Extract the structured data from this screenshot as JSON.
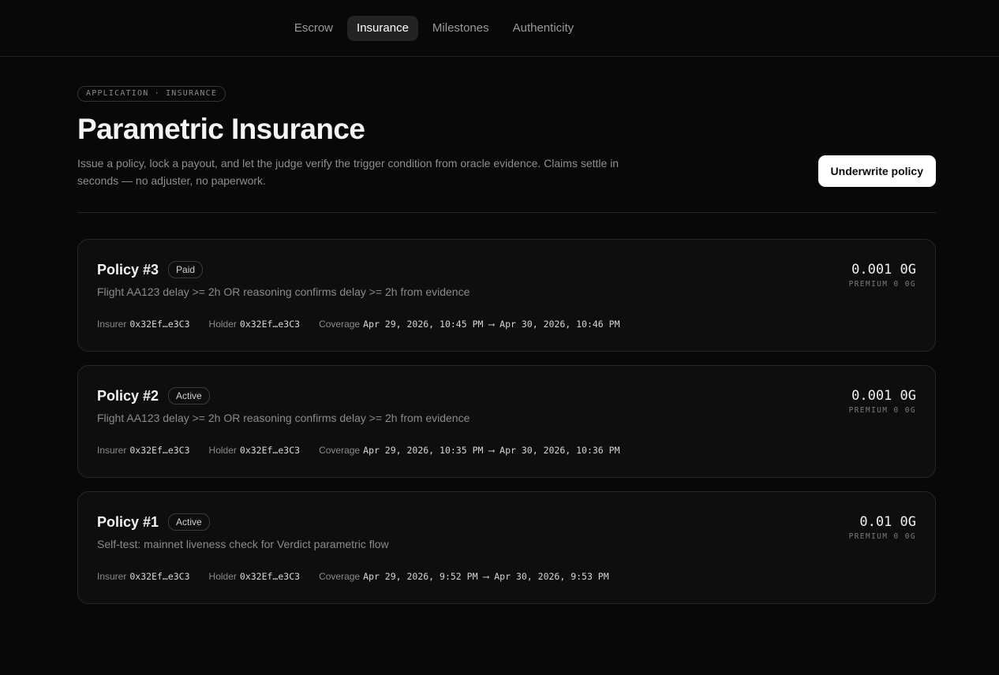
{
  "nav": {
    "tabs": [
      {
        "label": "Escrow"
      },
      {
        "label": "Insurance"
      },
      {
        "label": "Milestones"
      },
      {
        "label": "Authenticity"
      }
    ],
    "active_tab": "Insurance"
  },
  "header": {
    "eyebrow": "APPLICATION · INSURANCE",
    "title": "Parametric Insurance",
    "subtitle": "Issue a policy, lock a payout, and let the judge verify the trigger condition from oracle evidence. Claims settle in seconds — no adjuster, no paperwork.",
    "cta_label": "Underwrite policy"
  },
  "policies": [
    {
      "title": "Policy #3",
      "status": "Paid",
      "description": "Flight AA123 delay >= 2h OR reasoning confirms delay >= 2h from evidence",
      "amount": "0.001 0G",
      "premium": "PREMIUM 0 0G",
      "insurer_label": "Insurer",
      "insurer": "0x32Ef…e3C3",
      "holder_label": "Holder",
      "holder": "0x32Ef…e3C3",
      "coverage_label": "Coverage",
      "coverage": "Apr 29, 2026, 10:45 PM ⟶ Apr 30, 2026, 10:46 PM"
    },
    {
      "title": "Policy #2",
      "status": "Active",
      "description": "Flight AA123 delay >= 2h OR reasoning confirms delay >= 2h from evidence",
      "amount": "0.001 0G",
      "premium": "PREMIUM 0 0G",
      "insurer_label": "Insurer",
      "insurer": "0x32Ef…e3C3",
      "holder_label": "Holder",
      "holder": "0x32Ef…e3C3",
      "coverage_label": "Coverage",
      "coverage": "Apr 29, 2026, 10:35 PM ⟶ Apr 30, 2026, 10:36 PM"
    },
    {
      "title": "Policy #1",
      "status": "Active",
      "description": "Self-test: mainnet liveness check for Verdict parametric flow",
      "amount": "0.01 0G",
      "premium": "PREMIUM 0 0G",
      "insurer_label": "Insurer",
      "insurer": "0x32Ef…e3C3",
      "holder_label": "Holder",
      "holder": "0x32Ef…e3C3",
      "coverage_label": "Coverage",
      "coverage": "Apr 29, 2026, 9:52 PM ⟶ Apr 30, 2026, 9:53 PM"
    }
  ]
}
